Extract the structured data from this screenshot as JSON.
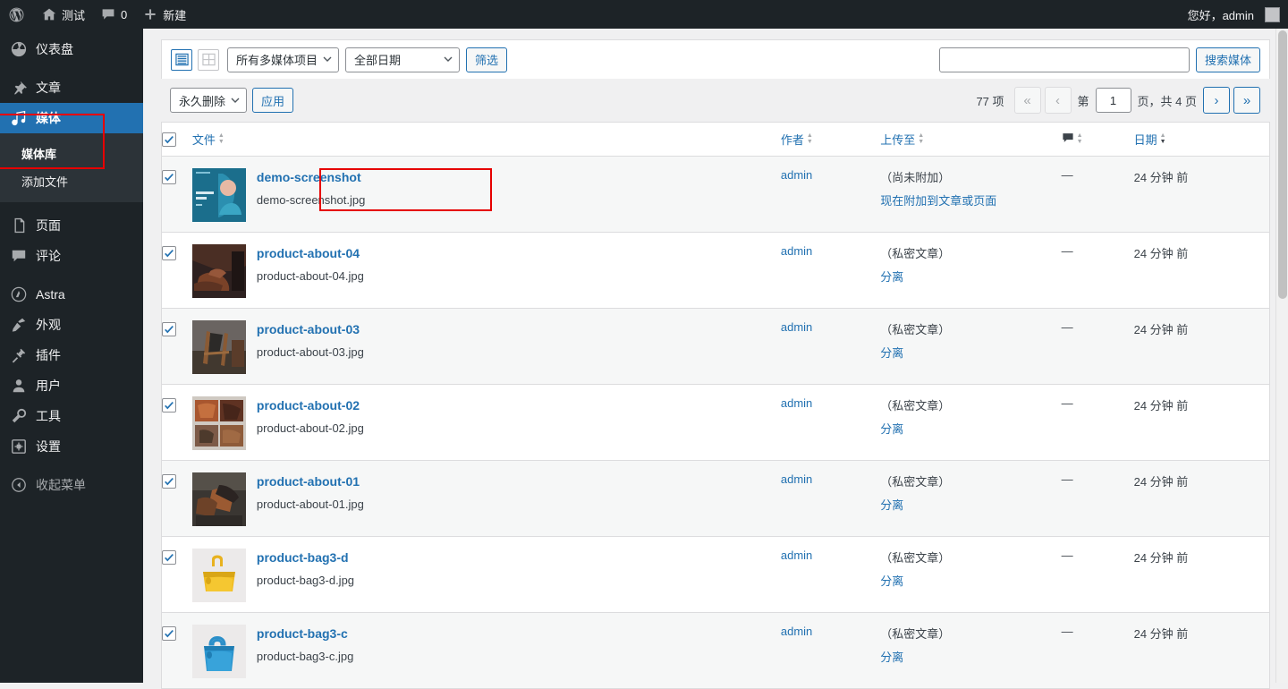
{
  "adminbar": {
    "logo_icon": "wordpress-logo-icon",
    "site_name": "测试",
    "home_icon": "home-icon",
    "comment_icon": "comment-icon",
    "comment_count": "0",
    "plus_icon": "plus-icon",
    "new_label": "新建",
    "greeting": "您好，admin",
    "avatar_icon": "avatar-icon"
  },
  "sidebar": {
    "items": [
      {
        "label": "仪表盘",
        "icon": "dashboard-icon",
        "current": false
      },
      {
        "label": "文章",
        "icon": "pin-icon",
        "current": false
      },
      {
        "label": "媒体",
        "icon": "media-icon",
        "current": true
      },
      {
        "label": "页面",
        "icon": "page-icon",
        "current": false
      },
      {
        "label": "评论",
        "icon": "comment-icon",
        "current": false
      },
      {
        "label": "Astra",
        "icon": "astra-icon",
        "current": false
      },
      {
        "label": "外观",
        "icon": "appearance-icon",
        "current": false
      },
      {
        "label": "插件",
        "icon": "plugin-icon",
        "current": false
      },
      {
        "label": "用户",
        "icon": "user-icon",
        "current": false
      },
      {
        "label": "工具",
        "icon": "tools-icon",
        "current": false
      },
      {
        "label": "设置",
        "icon": "settings-icon",
        "current": false
      }
    ],
    "submenu": [
      {
        "label": "媒体库",
        "current": true
      },
      {
        "label": "添加文件",
        "current": false
      }
    ],
    "collapse": {
      "label": "收起菜单",
      "icon": "collapse-arrow-icon"
    }
  },
  "highlights": {
    "accent_color": "#e60000",
    "boxes": [
      "sidebar-media-highlight",
      "bulk-actions-highlight"
    ]
  },
  "toolbar": {
    "list_view_icon": "list-view-icon",
    "grid_view_icon": "grid-view-icon",
    "type_filter": "所有多媒体项目",
    "date_filter": "全部日期",
    "filter_button": "筛选",
    "search_value": "",
    "search_placeholder": "",
    "search_button": "搜索媒体"
  },
  "bulk": {
    "action": "永久删除",
    "apply_label": "应用"
  },
  "pagination": {
    "total": "77 项",
    "first_icon": "«",
    "prev_icon": "‹",
    "page_prefix": "第",
    "current_page": "1",
    "page_suffix": "页，共 4 页",
    "next_icon": "›",
    "last_icon": "»"
  },
  "table": {
    "headers": {
      "select_all": "select-all-checkbox",
      "file": "文件",
      "author": "作者",
      "uploaded_to": "上传至",
      "comments": "comment-icon",
      "date": "日期"
    },
    "rows": [
      {
        "title": "demo-screenshot",
        "filename": "demo-screenshot.jpg",
        "author": "admin",
        "uploaded_to": "（尚未附加）",
        "uploaded_action": "现在附加到文章或页面",
        "comments": "—",
        "date": "24 分钟 前",
        "thumb": "teal-promo-screenshot",
        "checked": true
      },
      {
        "title": "product-about-04",
        "filename": "product-about-04.jpg",
        "author": "admin",
        "uploaded_to": "（私密文章）",
        "uploaded_action": "分离",
        "comments": "—",
        "date": "24 分钟 前",
        "thumb": "brown-shoes",
        "checked": true
      },
      {
        "title": "product-about-03",
        "filename": "product-about-03.jpg",
        "author": "admin",
        "uploaded_to": "（私密文章）",
        "uploaded_action": "分离",
        "comments": "—",
        "date": "24 分钟 前",
        "thumb": "dark-chair-bag",
        "checked": true
      },
      {
        "title": "product-about-02",
        "filename": "product-about-02.jpg",
        "author": "admin",
        "uploaded_to": "（私密文章）",
        "uploaded_action": "分离",
        "comments": "—",
        "date": "24 分钟 前",
        "thumb": "brown-bags-grid",
        "checked": true
      },
      {
        "title": "product-about-01",
        "filename": "product-about-01.jpg",
        "author": "admin",
        "uploaded_to": "（私密文章）",
        "uploaded_action": "分离",
        "comments": "—",
        "date": "24 分钟 前",
        "thumb": "dark-leather-shoes",
        "checked": true
      },
      {
        "title": "product-bag3-d",
        "filename": "product-bag3-d.jpg",
        "author": "admin",
        "uploaded_to": "（私密文章）",
        "uploaded_action": "分离",
        "comments": "—",
        "date": "24 分钟 前",
        "thumb": "yellow-bag",
        "checked": true
      },
      {
        "title": "product-bag3-c",
        "filename": "product-bag3-c.jpg",
        "author": "admin",
        "uploaded_to": "（私密文章）",
        "uploaded_action": "分离",
        "comments": "—",
        "date": "24 分钟 前",
        "thumb": "blue-bag",
        "checked": true
      }
    ]
  }
}
